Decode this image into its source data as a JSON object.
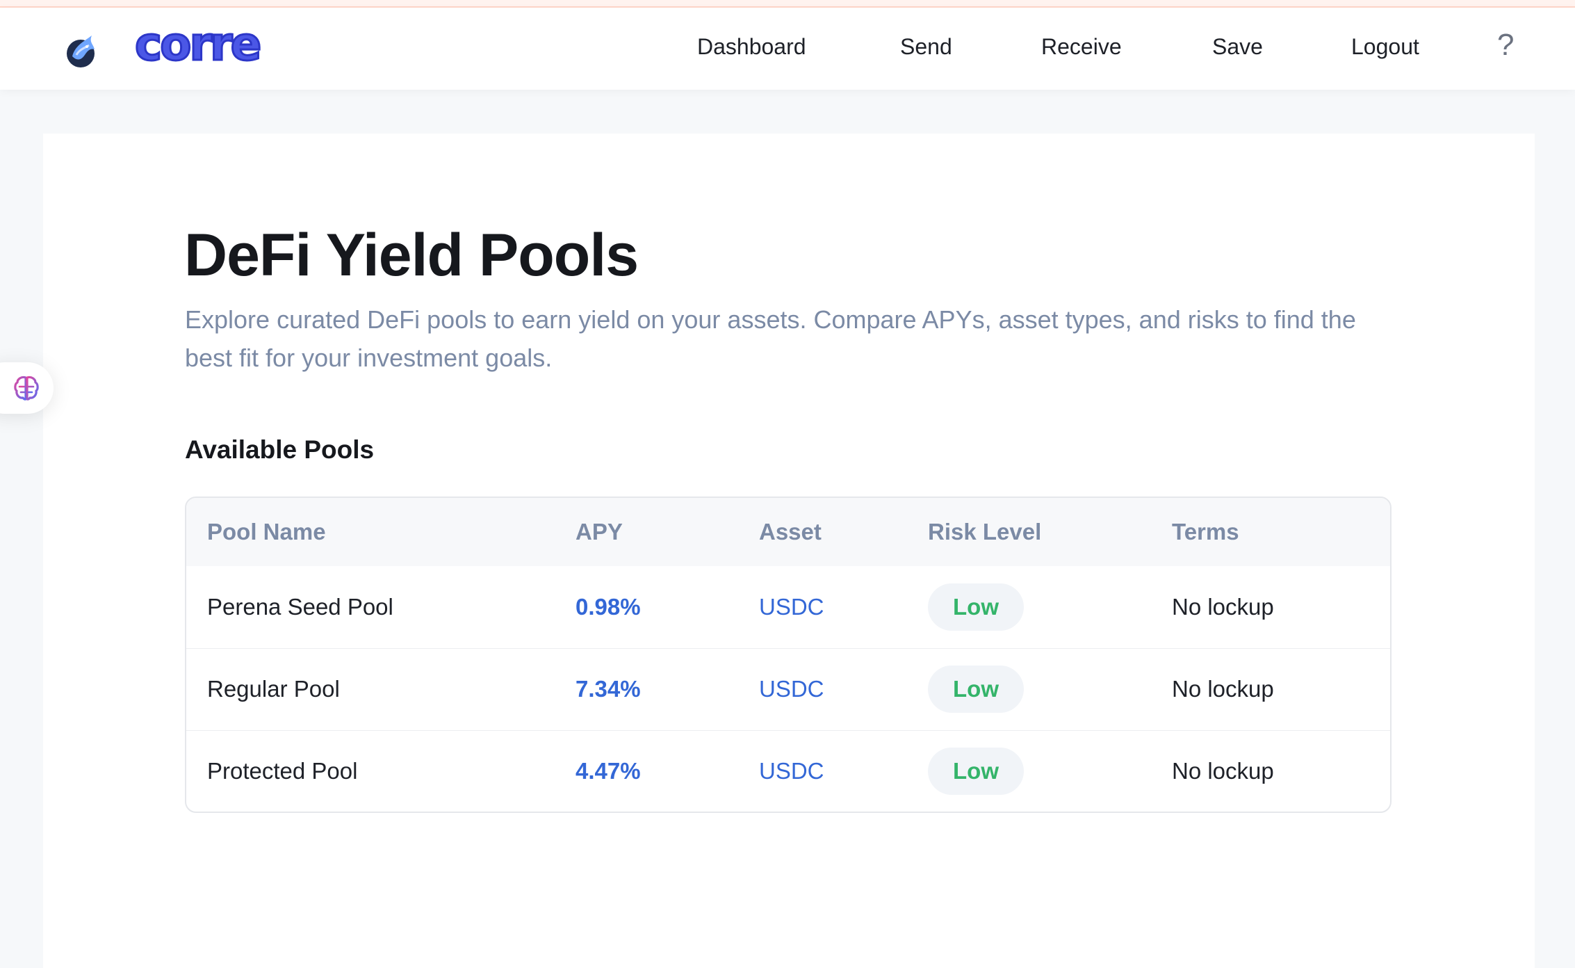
{
  "brand": {
    "name": "corre",
    "accent": "#4b57e6",
    "logo_icon": "dragon-logo-icon"
  },
  "nav": {
    "links": [
      {
        "label": "Dashboard"
      },
      {
        "label": "Send"
      },
      {
        "label": "Receive"
      },
      {
        "label": "Save"
      },
      {
        "label": "Logout"
      }
    ],
    "help_label": "?"
  },
  "side_tab": {
    "icon": "brain-icon"
  },
  "page": {
    "title": "DeFi Yield Pools",
    "description": "Explore curated DeFi pools to earn yield on your assets. Compare APYs, asset types, and risks to find the best fit for your investment goals.",
    "section_title": "Available Pools"
  },
  "table": {
    "headers": [
      "Pool Name",
      "APY",
      "Asset",
      "Risk Level",
      "Terms"
    ],
    "rows": [
      {
        "name": "Perena Seed Pool",
        "apy": "0.98%",
        "asset": "USDC",
        "risk": "Low",
        "terms": "No lockup"
      },
      {
        "name": "Regular Pool",
        "apy": "7.34%",
        "asset": "USDC",
        "risk": "Low",
        "terms": "No lockup"
      },
      {
        "name": "Protected Pool",
        "apy": "4.47%",
        "asset": "USDC",
        "risk": "Low",
        "terms": "No lockup"
      }
    ]
  },
  "colors": {
    "apy": "#3367d6",
    "risk_low": "#34b46a",
    "muted_text": "#7b8aa5"
  }
}
